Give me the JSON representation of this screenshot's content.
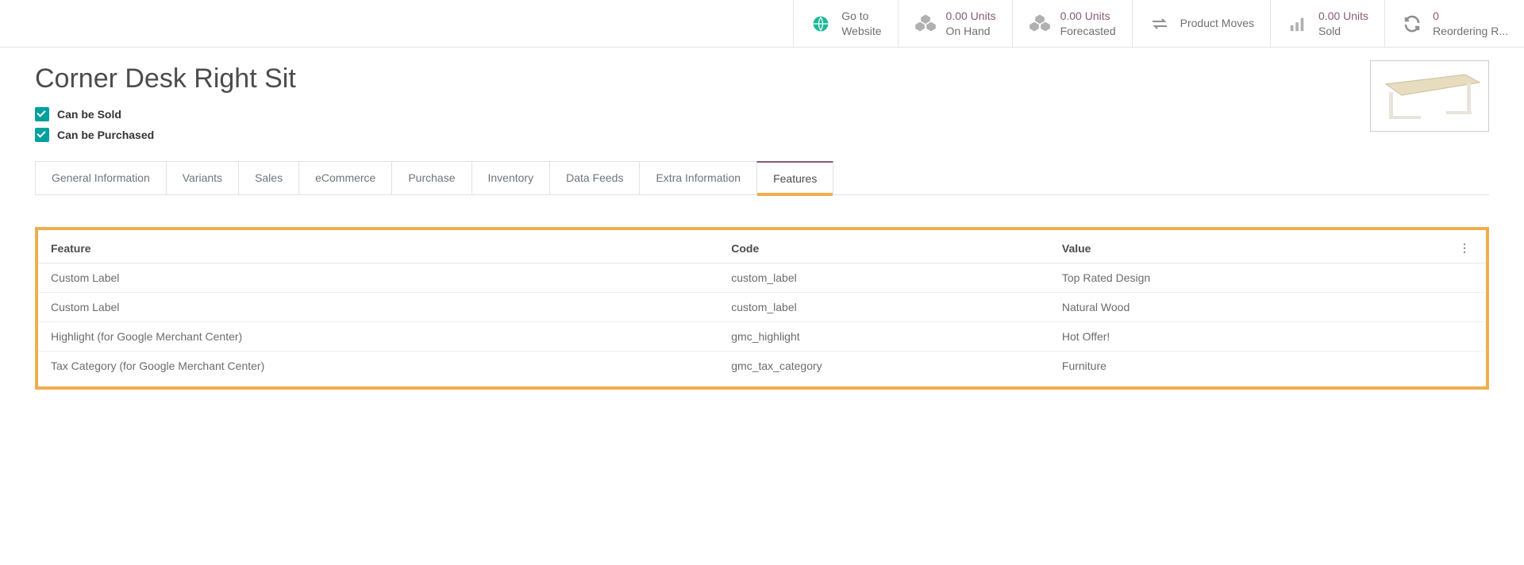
{
  "stats": {
    "website": {
      "label": "Go to",
      "sub": "Website"
    },
    "onhand": {
      "value": "0.00 Units",
      "label": "On Hand"
    },
    "forecast": {
      "value": "0.00 Units",
      "label": "Forecasted"
    },
    "moves": {
      "label": "Product Moves"
    },
    "sold": {
      "value": "0.00 Units",
      "label": "Sold"
    },
    "reorder": {
      "value": "0",
      "label": "Reordering R..."
    }
  },
  "product": {
    "title": "Corner Desk Right Sit",
    "can_be_sold": "Can be Sold",
    "can_be_purchased": "Can be Purchased"
  },
  "tabs": [
    "General Information",
    "Variants",
    "Sales",
    "eCommerce",
    "Purchase",
    "Inventory",
    "Data Feeds",
    "Extra Information",
    "Features"
  ],
  "active_tab": 8,
  "table": {
    "headers": [
      "Feature",
      "Code",
      "Value"
    ],
    "rows": [
      {
        "feature": "Custom Label",
        "code": "custom_label",
        "value": "Top Rated Design"
      },
      {
        "feature": "Custom Label",
        "code": "custom_label",
        "value": "Natural Wood"
      },
      {
        "feature": "Highlight (for Google Merchant Center)",
        "code": "gmc_highlight",
        "value": "Hot Offer!"
      },
      {
        "feature": "Tax Category (for Google Merchant Center)",
        "code": "gmc_tax_category",
        "value": "Furniture"
      }
    ]
  }
}
